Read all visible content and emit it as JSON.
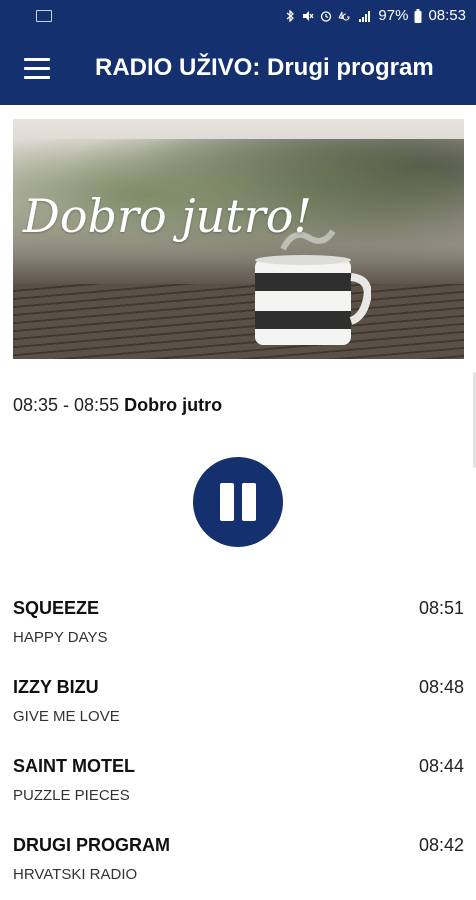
{
  "status_bar": {
    "battery": "97%",
    "time": "08:53",
    "icons": [
      "notification-icon",
      "bluetooth-icon",
      "mute-icon",
      "alarm-icon",
      "signal-4g-icon",
      "signal-bars-icon",
      "battery-icon"
    ]
  },
  "app_bar": {
    "title": "RADIO UŽIVO: Drugi program",
    "menu_icon": "hamburger-menu-icon",
    "color": "#14306e"
  },
  "hero": {
    "text": "Dobro jutro!"
  },
  "now_playing": {
    "time_range": "08:35 - 08:55",
    "program": "Dobro jutro"
  },
  "player": {
    "control_icon": "pause-icon"
  },
  "tracks": [
    {
      "artist": "SQUEEZE",
      "song": "HAPPY DAYS",
      "time": "08:51"
    },
    {
      "artist": "IZZY BIZU",
      "song": "GIVE ME LOVE",
      "time": "08:48"
    },
    {
      "artist": "SAINT MOTEL",
      "song": "PUZZLE PIECES",
      "time": "08:44"
    },
    {
      "artist": "DRUGI PROGRAM",
      "song": "HRVATSKI RADIO",
      "time": "08:42"
    }
  ]
}
